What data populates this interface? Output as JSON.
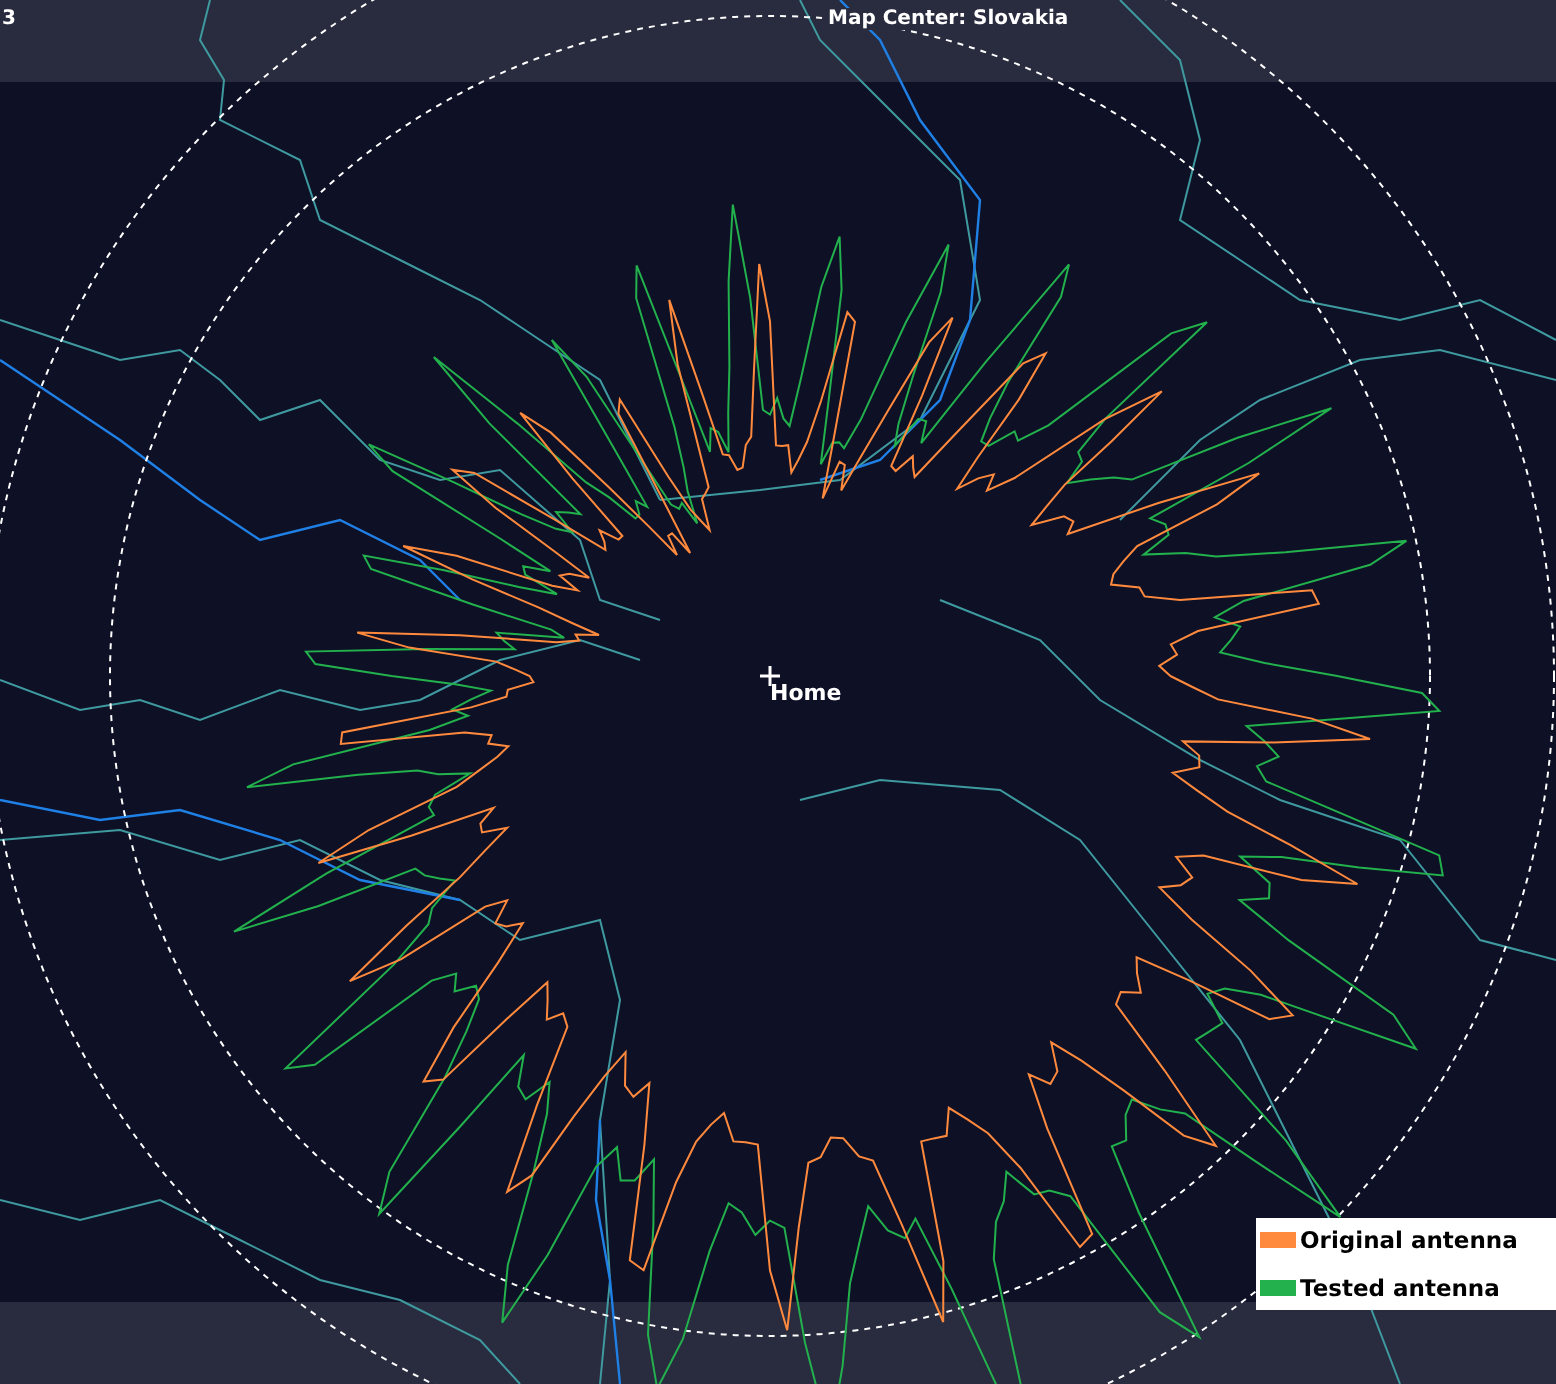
{
  "header": {
    "corner_text": "3",
    "title": "Map Center: Slovakia"
  },
  "map": {
    "home_label": "Home"
  },
  "legend": [
    {
      "label": "Original antenna",
      "color": "#ff8a3d"
    },
    {
      "label": "Tested antenna",
      "color": "#22b14c"
    }
  ]
}
